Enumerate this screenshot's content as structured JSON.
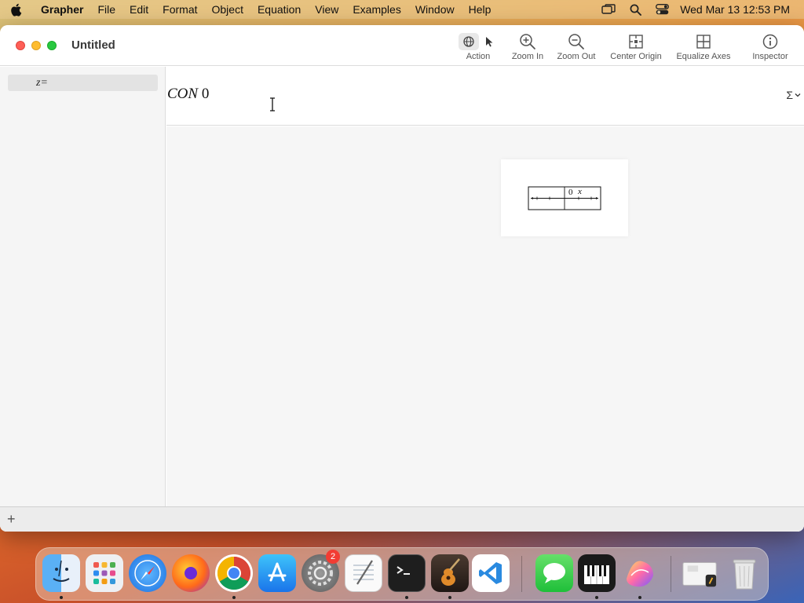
{
  "menubar": {
    "app_name": "Grapher",
    "items": [
      "File",
      "Edit",
      "Format",
      "Object",
      "Equation",
      "View",
      "Examples",
      "Window",
      "Help"
    ],
    "clock": "Wed Mar 13  12:53 PM"
  },
  "window": {
    "title": "Untitled"
  },
  "toolbar": {
    "action_label": "Action",
    "zoom_in_label": "Zoom In",
    "zoom_out_label": "Zoom Out",
    "center_origin_label": "Center Origin",
    "equalize_axes_label": "Equalize Axes",
    "inspector_label": "Inspector"
  },
  "sidebar": {
    "equation_item": "z="
  },
  "equation": {
    "text_italic": "CON",
    "text_number": " 0",
    "sigma": "Σ"
  },
  "graph_preview": {
    "origin_label": "0",
    "x_axis_label": "x"
  },
  "bottom": {
    "add_label": "+"
  },
  "dock": {
    "apps": [
      "Finder",
      "Launchpad",
      "Safari",
      "Firefox",
      "Chrome",
      "App Store",
      "System Settings",
      "TextEdit",
      "Terminal",
      "GarageBand",
      "Visual Studio Code",
      "Messages",
      "Piano",
      "Grapher Palette",
      "Preview",
      "Trash"
    ],
    "settings_badge": "2"
  },
  "colors": {
    "close": "#fe5f57",
    "minimize": "#febc2e",
    "maximize": "#28c840",
    "badge": "#f23c33"
  }
}
